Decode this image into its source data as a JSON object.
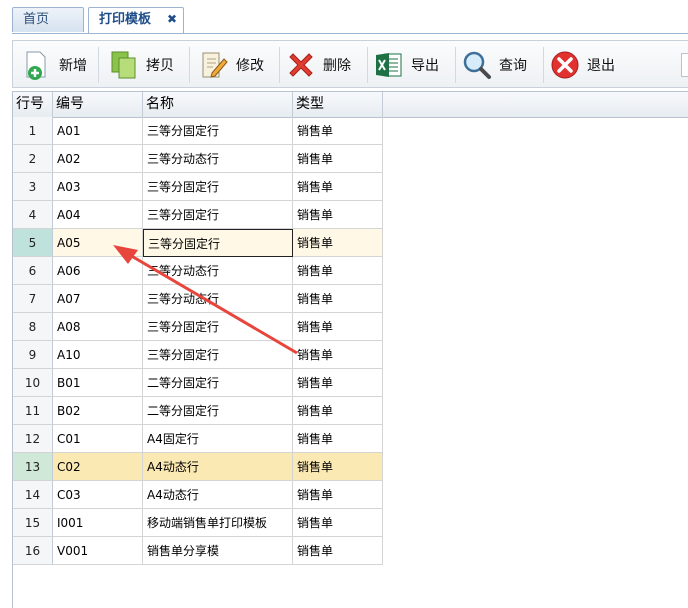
{
  "tabs": [
    {
      "label": "首页"
    },
    {
      "label": "打印模板",
      "close": "✖"
    }
  ],
  "toolbar": {
    "add": "新增",
    "copy": "拷贝",
    "edit": "修改",
    "delete": "删除",
    "export": "导出",
    "query": "查询",
    "exit": "退出"
  },
  "grid": {
    "headers": [
      "行号",
      "编号",
      "名称",
      "类型"
    ],
    "rows": [
      {
        "n": "1",
        "code": "A01",
        "name": "三等分固定行",
        "type": "销售单"
      },
      {
        "n": "2",
        "code": "A02",
        "name": "三等分动态行",
        "type": "销售单"
      },
      {
        "n": "3",
        "code": "A03",
        "name": "三等分固定行",
        "type": "销售单"
      },
      {
        "n": "4",
        "code": "A04",
        "name": "三等分固定行",
        "type": "销售单"
      },
      {
        "n": "5",
        "code": "A05",
        "name": "三等分固定行",
        "type": "销售单"
      },
      {
        "n": "6",
        "code": "A06",
        "name": "三等分动态行",
        "type": "销售单"
      },
      {
        "n": "7",
        "code": "A07",
        "name": "三等分动态行",
        "type": "销售单"
      },
      {
        "n": "8",
        "code": "A08",
        "name": "三等分固定行",
        "type": "销售单"
      },
      {
        "n": "9",
        "code": "A10",
        "name": "三等分固定行",
        "type": "销售单"
      },
      {
        "n": "10",
        "code": "B01",
        "name": "二等分固定行",
        "type": "销售单"
      },
      {
        "n": "11",
        "code": "B02",
        "name": "二等分固定行",
        "type": "销售单"
      },
      {
        "n": "12",
        "code": "C01",
        "name": "A4固定行",
        "type": "销售单"
      },
      {
        "n": "13",
        "code": "C02",
        "name": "A4动态行",
        "type": "销售单"
      },
      {
        "n": "14",
        "code": "C03",
        "name": "A4动态行",
        "type": "销售单"
      },
      {
        "n": "15",
        "code": "I001",
        "name": "移动端销售单打印模板",
        "type": "销售单"
      },
      {
        "n": "16",
        "code": "V001",
        "name": "销售单分享模",
        "type": "销售单"
      }
    ],
    "selected_row": "5",
    "highlighted_row": "13"
  },
  "colors": {
    "arrow": "#e8453c",
    "accent": "#1f4d8a"
  }
}
